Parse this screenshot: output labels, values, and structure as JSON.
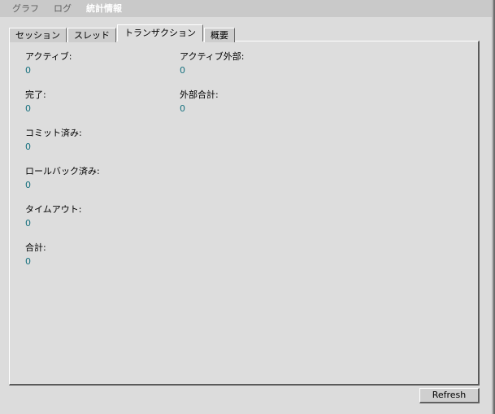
{
  "window": {
    "background_color": "#dcdcdc",
    "border_color": "#6b6b6b"
  },
  "menu_bar": {
    "background_color": "#c9c9c9",
    "items": [
      {
        "label": "グラフ",
        "state": "inactive"
      },
      {
        "label": "ログ",
        "state": "inactive"
      },
      {
        "label": "統計情報",
        "state": "active"
      }
    ]
  },
  "tabs": {
    "selected_index": 2,
    "items": [
      {
        "label": "セッション"
      },
      {
        "label": "スレッド"
      },
      {
        "label": "トランザクション"
      },
      {
        "label": "概要"
      }
    ]
  },
  "panel": {
    "background_color": "#dddddd",
    "value_color": "#16707e",
    "left_column": [
      {
        "label": "アクティブ:",
        "value": "0"
      },
      {
        "label": "完了:",
        "value": "0"
      },
      {
        "label": "コミット済み:",
        "value": "0"
      },
      {
        "label": "ロールバック済み:",
        "value": "0"
      },
      {
        "label": "タイムアウト:",
        "value": "0"
      },
      {
        "label": "合計:",
        "value": "0"
      }
    ],
    "right_column": [
      {
        "label": "アクティブ外部:",
        "value": "0"
      },
      {
        "label": "外部合計:",
        "value": "0"
      }
    ]
  },
  "footer": {
    "refresh_label": "Refresh"
  }
}
